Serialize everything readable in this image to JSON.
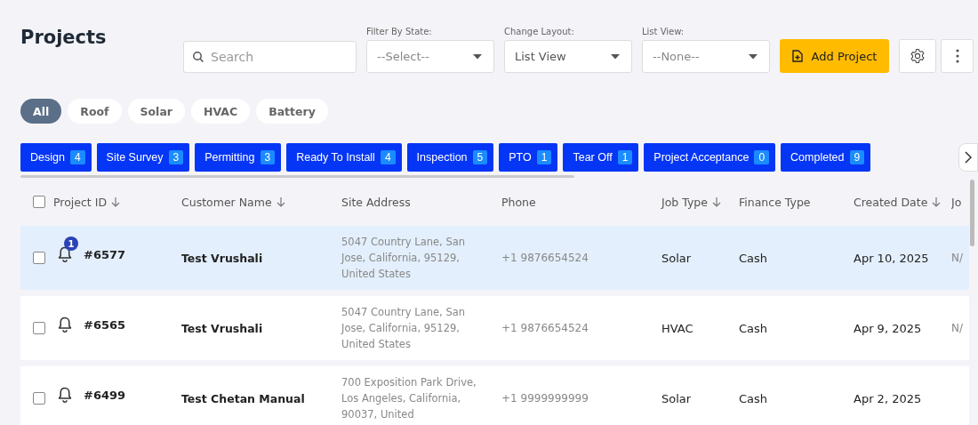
{
  "title": "Projects",
  "search": {
    "placeholder": "Search"
  },
  "dropdowns": [
    {
      "label": "Filter By State:",
      "value": "--Select--",
      "empty": true
    },
    {
      "label": "Change Layout:",
      "value": "List View",
      "empty": false
    },
    {
      "label": "List View:",
      "value": "--None--",
      "empty": true
    }
  ],
  "add_button": "Add Project",
  "categories": [
    {
      "label": "All",
      "selected": true
    },
    {
      "label": "Roof",
      "selected": false
    },
    {
      "label": "Solar",
      "selected": false
    },
    {
      "label": "HVAC",
      "selected": false
    },
    {
      "label": "Battery",
      "selected": false
    }
  ],
  "stages": [
    {
      "label": "Design",
      "count": "4"
    },
    {
      "label": "Site Survey",
      "count": "3"
    },
    {
      "label": "Permitting",
      "count": "3"
    },
    {
      "label": "Ready To Install",
      "count": "4"
    },
    {
      "label": "Inspection",
      "count": "5"
    },
    {
      "label": "PTO",
      "count": "1"
    },
    {
      "label": "Tear Off",
      "count": "1"
    },
    {
      "label": "Project Acceptance",
      "count": "0"
    },
    {
      "label": "Completed",
      "count": "9"
    }
  ],
  "table": {
    "select_all_checked": false,
    "columns": [
      {
        "label": "Project ID",
        "sortable": true
      },
      {
        "label": "Customer Name",
        "sortable": true
      },
      {
        "label": "Site Address",
        "sortable": false
      },
      {
        "label": "Phone",
        "sortable": false
      },
      {
        "label": "Job Type",
        "sortable": true
      },
      {
        "label": "Finance Type",
        "sortable": false
      },
      {
        "label": "Created Date",
        "sortable": true
      },
      {
        "label": "Jo",
        "sortable": false
      }
    ],
    "rows": [
      {
        "selected": true,
        "checked": false,
        "notifications": "1",
        "id": "#6577",
        "customer": "Test Vrushali",
        "address": "5047 Country Lane, San Jose, California, 95129, United States",
        "phone": "+1 9876654524",
        "job_type": "Solar",
        "finance": "Cash",
        "created": "Apr 10, 2025",
        "column_8": "N/"
      },
      {
        "selected": false,
        "checked": false,
        "id": "#6565",
        "customer": "Test Vrushali",
        "address": "5047 Country Lane, San Jose, California, 95129, United States",
        "phone": "+1 9876654524",
        "job_type": "HVAC",
        "finance": "Cash",
        "created": "Apr 9, 2025",
        "column_8": "N/"
      },
      {
        "selected": false,
        "checked": false,
        "id": "#6499",
        "customer": "Test Chetan Manual",
        "address": "700 Exposition Park Drive, Los Angeles, California, 90037, United",
        "phone": "+1 9999999999",
        "job_type": "Solar",
        "finance": "Cash",
        "created": "Apr 2, 2025"
      }
    ]
  }
}
